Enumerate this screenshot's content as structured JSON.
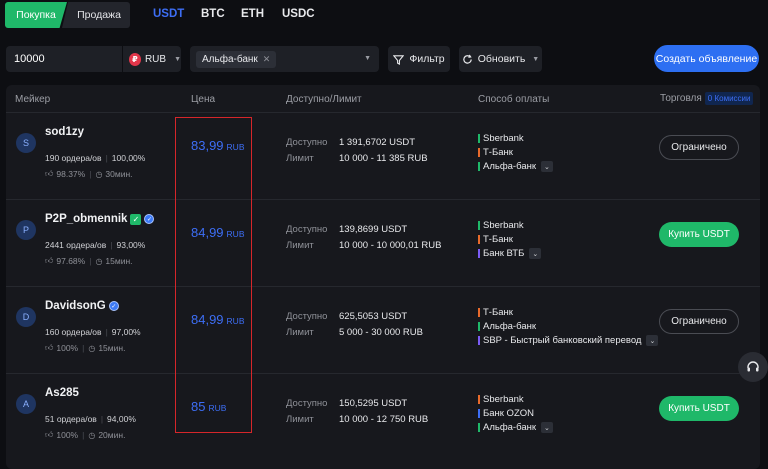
{
  "side_tabs": {
    "buy": "Покупка",
    "sell": "Продажа"
  },
  "coins": [
    "USDT",
    "BTC",
    "ETH",
    "USDC"
  ],
  "active_coin": "USDT",
  "filters": {
    "amount": "10000",
    "currency": "RUB",
    "currency_icon": "₽",
    "bank_chip": "Альфа-банк",
    "filter_label": "Фильтр",
    "refresh_label": "Обновить",
    "create_ad_label": "Создать объявление"
  },
  "headers": {
    "maker": "Мейкер",
    "price": "Цена",
    "available_limit": "Доступно/Лимит",
    "payment_method": "Способ оплаты",
    "trade": "Торговля",
    "commission": "0 Комиссии"
  },
  "labels": {
    "available": "Доступно",
    "limit": "Лимит"
  },
  "colors": {
    "accent_blue": "#3d6ef5",
    "buy_green": "#1fb869",
    "sberbank": "#1fb869",
    "tbank": "#e86a2b",
    "alfa": "#1fb869",
    "vtb": "#7b5cf5",
    "sbp": "#7b5cf5",
    "ozon": "#3d6ef5",
    "highlight": "#d6262a"
  },
  "rows": [
    {
      "avatar": "S",
      "name": "sod1zy",
      "verified": false,
      "badge": false,
      "orders": "190 ордера/ов",
      "completion": "100,00%",
      "like_rate": "98.37%",
      "time": "30мин.",
      "price": "83,99",
      "price_cur": "RUB",
      "available": "1 391,6702 USDT",
      "limit": "10 000 - 11 385 RUB",
      "payments": [
        {
          "name": "Sberbank",
          "color": "#1fb869"
        },
        {
          "name": "Т-Банк",
          "color": "#e86a2b"
        },
        {
          "name": "Альфа-банк",
          "color": "#1fb869",
          "more": true
        }
      ],
      "action": "Ограничено",
      "action_type": "limited"
    },
    {
      "avatar": "P",
      "name": "P2P_obmennik",
      "verified": true,
      "badge": true,
      "orders": "2441 ордера/ов",
      "completion": "93,00%",
      "like_rate": "97.68%",
      "time": "15мин.",
      "price": "84,99",
      "price_cur": "RUB",
      "available": "139,8699 USDT",
      "limit": "10 000 - 10 000,01 RUB",
      "payments": [
        {
          "name": "Sberbank",
          "color": "#1fb869"
        },
        {
          "name": "Т-Банк",
          "color": "#e86a2b"
        },
        {
          "name": "Банк ВТБ",
          "color": "#7b5cf5",
          "more": true
        }
      ],
      "action": "Купить USDT",
      "action_type": "buy"
    },
    {
      "avatar": "D",
      "name": "DavidsonG",
      "verified": false,
      "badge": true,
      "orders": "160 ордера/ов",
      "completion": "97,00%",
      "like_rate": "100%",
      "time": "15мин.",
      "price": "84,99",
      "price_cur": "RUB",
      "available": "625,5053 USDT",
      "limit": "5 000 - 30 000 RUB",
      "payments": [
        {
          "name": "Т-Банк",
          "color": "#e86a2b"
        },
        {
          "name": "Альфа-банк",
          "color": "#1fb869"
        },
        {
          "name": "SBP - Быстрый банковский перевод",
          "color": "#7b5cf5",
          "more": true
        }
      ],
      "action": "Ограничено",
      "action_type": "limited"
    },
    {
      "avatar": "A",
      "name": "As285",
      "verified": false,
      "badge": false,
      "orders": "51 ордера/ов",
      "completion": "94,00%",
      "like_rate": "100%",
      "time": "20мин.",
      "price": "85",
      "price_cur": "RUB",
      "available": "150,5295 USDT",
      "limit": "10 000 - 12 750 RUB",
      "payments": [
        {
          "name": "Sberbank",
          "color": "#e86a2b"
        },
        {
          "name": "Банк OZON",
          "color": "#3d6ef5"
        },
        {
          "name": "Альфа-банк",
          "color": "#1fb869",
          "more": true
        }
      ],
      "action": "Купить USDT",
      "action_type": "buy"
    }
  ]
}
